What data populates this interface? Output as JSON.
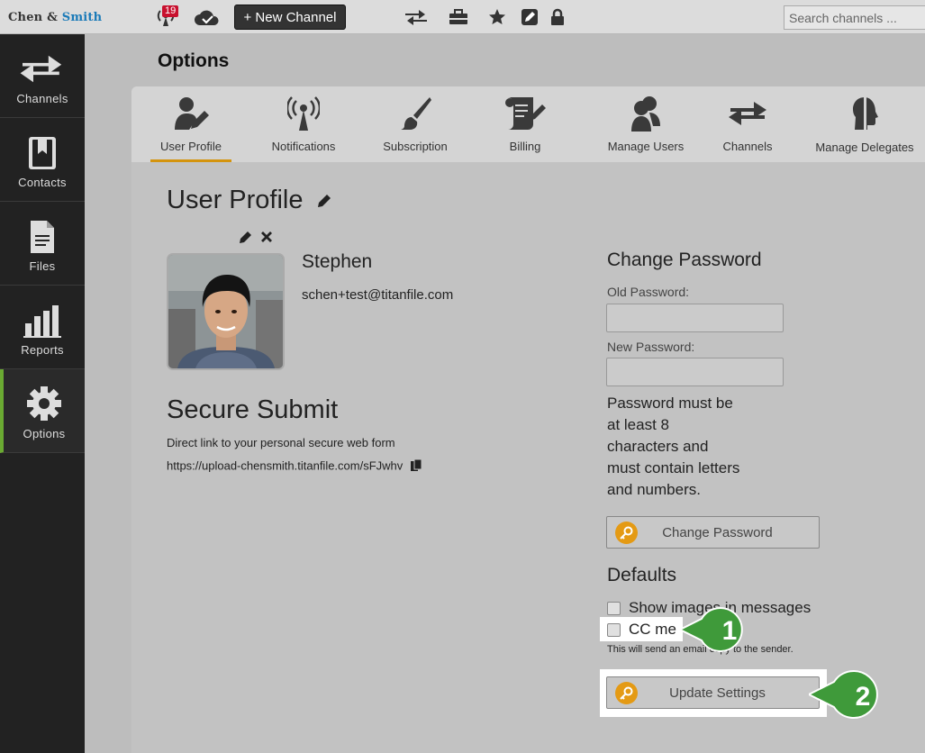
{
  "brand": {
    "part1": "Chen",
    "amp": "&",
    "part2": "Smith"
  },
  "topbar": {
    "notifications_count": "19",
    "new_channel_label": "+ New Channel",
    "search_placeholder": "Search channels ..."
  },
  "sidebar": {
    "items": [
      {
        "label": "Channels",
        "icon": "arrows-exchange-icon"
      },
      {
        "label": "Contacts",
        "icon": "contacts-book-icon"
      },
      {
        "label": "Files",
        "icon": "file-icon"
      },
      {
        "label": "Reports",
        "icon": "bar-chart-icon"
      },
      {
        "label": "Options",
        "icon": "gear-icon",
        "active": true
      }
    ]
  },
  "page": {
    "title": "Options"
  },
  "tabs": [
    {
      "label": "User Profile",
      "icon": "user-edit-icon",
      "active": true
    },
    {
      "label": "Notifications",
      "icon": "broadcast-icon"
    },
    {
      "label": "Subscription",
      "icon": "brush-icon"
    },
    {
      "label": "Billing",
      "icon": "scroll-edit-icon"
    },
    {
      "label": "Manage Users",
      "icon": "users-icon"
    },
    {
      "label": "Channels",
      "icon": "arrows-exchange-icon"
    },
    {
      "label": "Manage Delegates",
      "icon": "delegate-head-icon"
    }
  ],
  "profile": {
    "section_title": "User Profile",
    "name": "Stephen",
    "email": "schen+test@titanfile.com"
  },
  "secure_submit": {
    "title": "Secure Submit",
    "description": "Direct link to your personal secure web form",
    "link": "https://upload-chensmith.titanfile.com/sFJwhv"
  },
  "change_password": {
    "title": "Change Password",
    "old_label": "Old Password:",
    "new_label": "New Password:",
    "rule_lines": [
      "Password must be",
      "at least 8",
      "characters and",
      "must contain letters",
      "and numbers."
    ],
    "button_label": "Change Password"
  },
  "defaults": {
    "title": "Defaults",
    "show_images_label": "Show images in messages",
    "cc_me_label": "CC me",
    "cc_me_note": "This will send an email copy to the sender.",
    "update_button_label": "Update Settings"
  },
  "callouts": [
    {
      "number": "1"
    },
    {
      "number": "2"
    }
  ],
  "colors": {
    "accent_orange": "#d4940e",
    "active_green": "#6aaa32",
    "callout_green": "#3f9a3a",
    "badge_red": "#c8102e"
  }
}
